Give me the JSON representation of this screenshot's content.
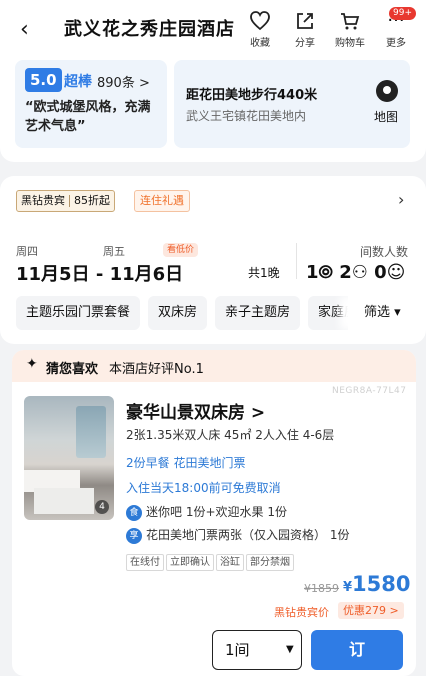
{
  "header": {
    "title": "武义花之秀庄园酒店",
    "actions": [
      {
        "label": "收藏",
        "icon": "heart-icon"
      },
      {
        "label": "分享",
        "icon": "share-icon"
      },
      {
        "label": "购物车",
        "icon": "cart-icon"
      },
      {
        "label": "更多",
        "icon": "more-icon"
      }
    ],
    "badge": "99+"
  },
  "rating": {
    "score": "5.0",
    "level": "超棒",
    "count": "890条 >",
    "quote": "“欧式城堡风格，充满艺术气息”"
  },
  "location": {
    "distance": "距花田美地步行440米",
    "address": "武义王宅镇花田美地内",
    "map_label": "地图"
  },
  "promo": {
    "vip_label": "黑钻贵宾",
    "vip_discount": "85折起",
    "stay_gift": "连住礼遇"
  },
  "dates": {
    "checkin_week": "周四",
    "checkout_week": "周五",
    "low_price_tag": "看低价",
    "range": "11月5日 - 11月6日",
    "nights": "共1晚",
    "guests_label": "间数人数",
    "guests": "1⦾ 2⚇ 0☺"
  },
  "filters": [
    "主题乐园门票套餐",
    "双床房",
    "亲子主题房",
    "家庭房"
  ],
  "sort_label": "筛选 ▾",
  "guess": {
    "title": "猜您喜欢",
    "subtitle": "本酒店好评No.1",
    "code": "NEGR8A-77L47"
  },
  "room": {
    "photo_count": "4",
    "name": "豪华山景双床房 >",
    "spec": "2张1.35米双人床  45㎡  2人入住  4-6层",
    "breakfast": "2份早餐    花田美地门票",
    "cancel": "入住当天18:00前可免费取消",
    "perk1_icon": "食",
    "perk1": "迷你吧 1份+欢迎水果 1份",
    "perk2_icon": "享",
    "perk2": "花田美地门票两张（仅入园资格） 1份",
    "tags": [
      "在线付",
      "立即确认",
      "浴缸",
      "部分禁烟"
    ],
    "original_price": "¥1859",
    "currency": "¥",
    "price": "1580",
    "vip_price_label": "黑钻贵宾价",
    "discount": "优惠279 >",
    "qty": "1间",
    "book_label": "订"
  }
}
